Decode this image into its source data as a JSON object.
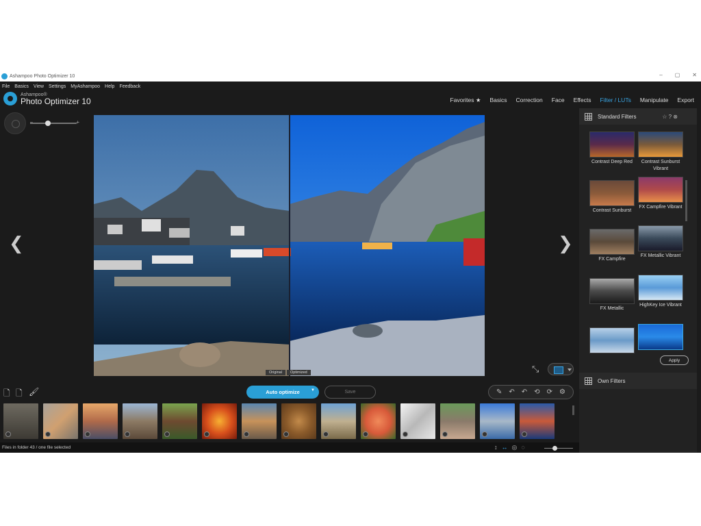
{
  "window": {
    "title": "Ashampoo Photo Optimizer 10",
    "minimize": "–",
    "maximize": "▢",
    "close": "✕"
  },
  "menu": [
    "File",
    "Basics",
    "View",
    "Settings",
    "MyAshampoo",
    "Help",
    "Feedback"
  ],
  "logo": {
    "brand": "Ashampoo®",
    "product": "Photo Optimizer 10"
  },
  "tabs": [
    {
      "label": "Favorites ★",
      "active": false
    },
    {
      "label": "Basics",
      "active": false
    },
    {
      "label": "Correction",
      "active": false
    },
    {
      "label": "Face",
      "active": false
    },
    {
      "label": "Effects",
      "active": false
    },
    {
      "label": "Filter / LUTs",
      "active": true
    },
    {
      "label": "Manipulate",
      "active": false
    },
    {
      "label": "Export",
      "active": false
    }
  ],
  "zoom": {
    "minus": "–",
    "plus": "+"
  },
  "nav": {
    "prev": "❮",
    "next": "❯"
  },
  "compare": {
    "original": "Original",
    "optimized": "Optimized"
  },
  "actions": {
    "auto_optimize": "Auto optimize",
    "save": "Save"
  },
  "status": {
    "text": "Files in folder 43 / one file selected"
  },
  "side_panel": {
    "standard_title": "Standard Filters",
    "standard_actions": "☆ ? ⊗",
    "own_title": "Own Filters",
    "apply": "Apply",
    "filters": [
      {
        "label": "Contrast Deep Red"
      },
      {
        "label": "Contrast Sunburst Vibrant"
      },
      {
        "label": "Contrast Sunburst"
      },
      {
        "label": "FX Campfire Vibrant"
      },
      {
        "label": "FX Campfire"
      },
      {
        "label": "FX Metallic Vibrant"
      },
      {
        "label": "FX Metallic"
      },
      {
        "label": "HighKey Ice Vibrant"
      },
      {
        "label": ""
      },
      {
        "label": ""
      }
    ]
  },
  "thumbnails_count": 14,
  "colors": {
    "accent": "#2a9fd6",
    "bg": "#1b1b1b",
    "panel": "#222222"
  }
}
